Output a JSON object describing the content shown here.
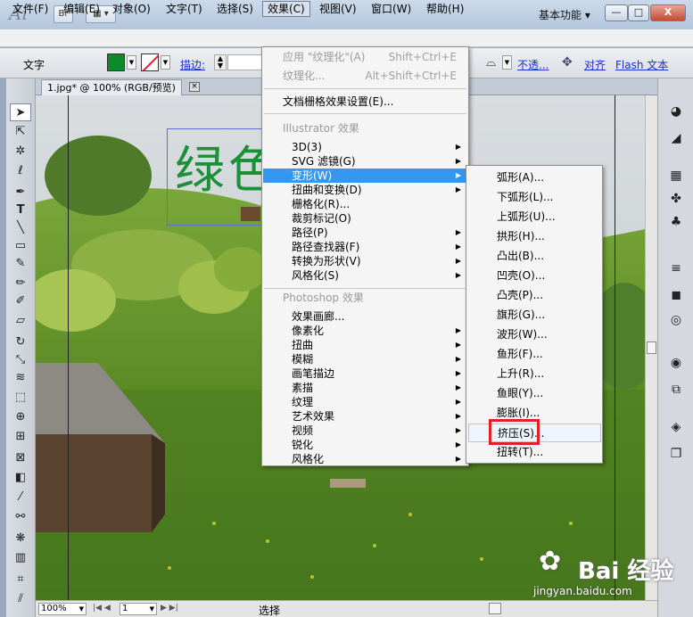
{
  "app": {
    "logo": "Ai",
    "bridge_label": "Br",
    "workspace": "基本功能",
    "window_buttons": {
      "minimize": "—",
      "maximize": "□",
      "close": "X"
    }
  },
  "menubar": [
    "文件(F)",
    "编辑(E)",
    "对象(O)",
    "文字(T)",
    "选择(S)",
    "效果(C)",
    "视图(V)",
    "窗口(W)",
    "帮助(H)"
  ],
  "toolbar": {
    "type_label": "文字",
    "stroke_label": "描边:",
    "opacity_link": "不透...",
    "align_link": "对齐",
    "flash_text": "Flash 文本",
    "colors": {
      "fill": "#0c8a2c",
      "stroke_slash": "#e0202a"
    }
  },
  "document": {
    "tab_title": "1.jpg* @ 100% (RGB/预览)",
    "canvas_text": "绿色",
    "zoom": "100%",
    "page": "1",
    "status": "选择"
  },
  "effect_menu": {
    "apply_last": {
      "label": "应用 \"纹理化\"(A)",
      "shortcut": "Shift+Ctrl+E"
    },
    "last_effect": {
      "label": "纹理化...",
      "shortcut": "Alt+Shift+Ctrl+E"
    },
    "raster_settings": "文档栅格效果设置(E)...",
    "illustrator_header": "Illustrator 效果",
    "illustrator_items": [
      "3D(3)",
      "SVG 滤镜(G)",
      "变形(W)",
      "扭曲和变换(D)",
      "栅格化(R)...",
      "裁剪标记(O)",
      "路径(P)",
      "路径查找器(F)",
      "转换为形状(V)",
      "风格化(S)"
    ],
    "photoshop_header": "Photoshop 效果",
    "photoshop_items": [
      "效果画廊...",
      "像素化",
      "扭曲",
      "模糊",
      "画笔描边",
      "素描",
      "纹理",
      "艺术效果",
      "视频",
      "锐化",
      "风格化"
    ]
  },
  "warp_menu": {
    "items": [
      "弧形(A)...",
      "下弧形(L)...",
      "上弧形(U)...",
      "拱形(H)...",
      "凸出(B)...",
      "凹壳(O)...",
      "凸壳(P)...",
      "旗形(G)...",
      "波形(W)...",
      "鱼形(F)...",
      "上升(R)...",
      "鱼眼(Y)...",
      "膨胀(I)...",
      "挤压(S)...",
      "扭转(T)..."
    ]
  },
  "watermark": {
    "brand": "Bai 经验",
    "url": "jingyan.baidu.com"
  }
}
